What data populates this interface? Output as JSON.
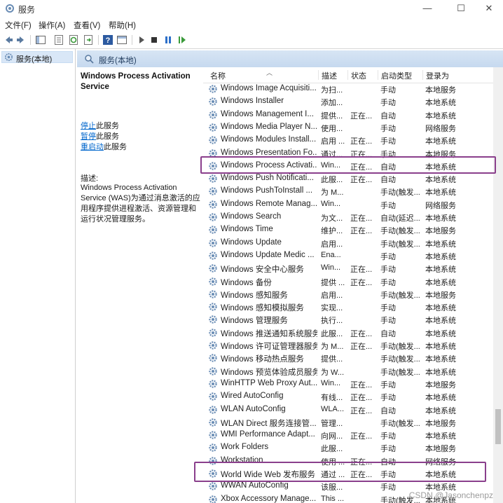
{
  "window": {
    "title": "服务",
    "controls": {
      "minimize": "—",
      "maximize": "☐",
      "close": "✕"
    }
  },
  "menu": [
    "文件(F)",
    "操作(A)",
    "查看(V)",
    "帮助(H)"
  ],
  "toolbar": {
    "icons": [
      "back-arrow-icon",
      "forward-arrow-icon",
      "show-tree-icon",
      "properties-icon",
      "refresh-icon",
      "export-icon",
      "help-icon",
      "console-icon",
      "start-service-icon",
      "stop-service-icon",
      "pause-service-icon",
      "restart-service-icon"
    ]
  },
  "tree": {
    "root_label": "服务(本地)"
  },
  "pane": {
    "header_label": "服务(本地)"
  },
  "details": {
    "service_title": "Windows Process Activation Service",
    "actions": [
      {
        "link": "停止",
        "suffix": "此服务"
      },
      {
        "link": "暂停",
        "suffix": "此服务"
      },
      {
        "link": "重启动",
        "suffix": "此服务"
      }
    ],
    "desc_label": "描述:",
    "description": "Windows Process Activation Service (WAS)为通过消息激活的应用程序提供进程激活、资源管理和运行状况管理服务。"
  },
  "columns": [
    "名称",
    "描述",
    "状态",
    "启动类型",
    "登录为"
  ],
  "services": [
    {
      "name": "Windows Image Acquisiti...",
      "desc": "为扫...",
      "status": "",
      "startup": "手动",
      "logon": "本地服务"
    },
    {
      "name": "Windows Installer",
      "desc": "添加...",
      "status": "",
      "startup": "手动",
      "logon": "本地系统"
    },
    {
      "name": "Windows Management I...",
      "desc": "提供...",
      "status": "正在...",
      "startup": "自动",
      "logon": "本地系统"
    },
    {
      "name": "Windows Media Player N...",
      "desc": "使用...",
      "status": "",
      "startup": "手动",
      "logon": "网络服务"
    },
    {
      "name": "Windows Modules Install...",
      "desc": "启用 ...",
      "status": "正在...",
      "startup": "手动",
      "logon": "本地系统"
    },
    {
      "name": "Windows Presentation Fo...",
      "desc": "通过...",
      "status": "正在...",
      "startup": "手动",
      "logon": "本地服务"
    },
    {
      "name": "Windows Process Activati...",
      "desc": "Win...",
      "status": "正在...",
      "startup": "自动",
      "logon": "本地系统"
    },
    {
      "name": "Windows Push Notificati...",
      "desc": "此服...",
      "status": "正在...",
      "startup": "自动",
      "logon": "本地系统"
    },
    {
      "name": "Windows PushToInstall ...",
      "desc": "为 M...",
      "status": "",
      "startup": "手动(触发...",
      "logon": "本地系统"
    },
    {
      "name": "Windows Remote Manag...",
      "desc": "Win...",
      "status": "",
      "startup": "手动",
      "logon": "网络服务"
    },
    {
      "name": "Windows Search",
      "desc": "为文...",
      "status": "正在...",
      "startup": "自动(延迟...",
      "logon": "本地系统"
    },
    {
      "name": "Windows Time",
      "desc": "维护...",
      "status": "正在...",
      "startup": "手动(触发...",
      "logon": "本地服务"
    },
    {
      "name": "Windows Update",
      "desc": "启用...",
      "status": "",
      "startup": "手动(触发...",
      "logon": "本地系统"
    },
    {
      "name": "Windows Update Medic ...",
      "desc": "Ena...",
      "status": "",
      "startup": "手动",
      "logon": "本地系统"
    },
    {
      "name": "Windows 安全中心服务",
      "desc": "Win...",
      "status": "正在...",
      "startup": "手动",
      "logon": "本地系统"
    },
    {
      "name": "Windows 备份",
      "desc": "提供 ...",
      "status": "正在...",
      "startup": "手动",
      "logon": "本地系统"
    },
    {
      "name": "Windows 感知服务",
      "desc": "启用...",
      "status": "",
      "startup": "手动(触发...",
      "logon": "本地服务"
    },
    {
      "name": "Windows 感知模拟服务",
      "desc": "实现...",
      "status": "",
      "startup": "手动",
      "logon": "本地系统"
    },
    {
      "name": "Windows 管理服务",
      "desc": "执行...",
      "status": "",
      "startup": "手动",
      "logon": "本地系统"
    },
    {
      "name": "Windows 推送通知系统服务",
      "desc": "此服...",
      "status": "正在...",
      "startup": "自动",
      "logon": "本地系统"
    },
    {
      "name": "Windows 许可证管理器服务",
      "desc": "为 M...",
      "status": "正在...",
      "startup": "手动(触发...",
      "logon": "本地系统"
    },
    {
      "name": "Windows 移动热点服务",
      "desc": "提供...",
      "status": "",
      "startup": "手动(触发...",
      "logon": "本地系统"
    },
    {
      "name": "Windows 预览体验成员服务",
      "desc": "为 W...",
      "status": "",
      "startup": "手动(触发...",
      "logon": "本地系统"
    },
    {
      "name": "WinHTTP Web Proxy Aut...",
      "desc": "Win...",
      "status": "正在...",
      "startup": "手动",
      "logon": "本地服务"
    },
    {
      "name": "Wired AutoConfig",
      "desc": "有线...",
      "status": "正在...",
      "startup": "手动",
      "logon": "本地系统"
    },
    {
      "name": "WLAN AutoConfig",
      "desc": "WLA...",
      "status": "正在...",
      "startup": "自动",
      "logon": "本地系统"
    },
    {
      "name": "WLAN Direct 服务连接管...",
      "desc": "管理...",
      "status": "",
      "startup": "手动(触发...",
      "logon": "本地服务"
    },
    {
      "name": "WMI Performance Adapt...",
      "desc": "向网...",
      "status": "正在...",
      "startup": "手动",
      "logon": "本地系统"
    },
    {
      "name": "Work Folders",
      "desc": "此服...",
      "status": "",
      "startup": "手动",
      "logon": "本地服务"
    },
    {
      "name": "Workstation",
      "desc": "使用 ...",
      "status": "正在...",
      "startup": "自动",
      "logon": "网络服务"
    },
    {
      "name": "World Wide Web 发布服务",
      "desc": "通过 ...",
      "status": "正在...",
      "startup": "手动",
      "logon": "本地系统"
    },
    {
      "name": "WWAN AutoConfig",
      "desc": "该服...",
      "status": "",
      "startup": "手动",
      "logon": "本地系统"
    },
    {
      "name": "Xbox Accessory Manage...",
      "desc": "This ...",
      "status": "",
      "startup": "手动(触发...",
      "logon": "本地系统"
    }
  ],
  "highlight_color": "#8a3f8c",
  "watermark": "CSDN @Jasonchenpz"
}
